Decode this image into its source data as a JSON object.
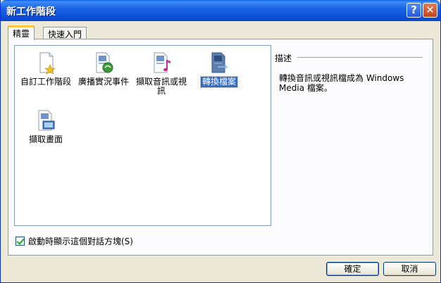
{
  "window": {
    "title": "新工作階段",
    "help_glyph": "?",
    "close_glyph": "✕"
  },
  "tabs": [
    {
      "label": "精靈",
      "active": true
    },
    {
      "label": "快速入門",
      "active": false
    }
  ],
  "items": [
    {
      "label": "自訂工作階段",
      "icon": "custom-session-icon"
    },
    {
      "label": "廣播實況事件",
      "icon": "broadcast-live-icon"
    },
    {
      "label": "擷取音訊或視訊",
      "icon": "capture-av-icon"
    },
    {
      "label": "轉換檔案",
      "icon": "convert-file-icon",
      "selected": true
    },
    {
      "label": "擷取畫面",
      "icon": "capture-screen-icon"
    }
  ],
  "description": {
    "heading": "描述",
    "text": "轉換音訊或視訊檔成為 Windows Media 檔案。"
  },
  "startup_checkbox": {
    "label": "啟動時顯示這個對話方塊(S)",
    "checked": true
  },
  "buttons": {
    "ok": "確定",
    "cancel": "取消"
  },
  "colors": {
    "title_bar": "#0c4fd8",
    "selection": "#316ac5",
    "tab_accent": "#ffc83c"
  }
}
